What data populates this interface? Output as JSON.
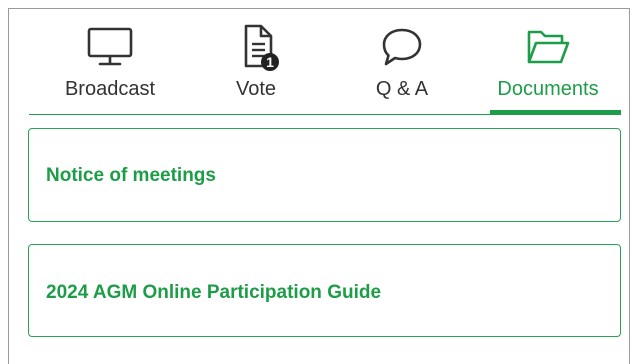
{
  "tabs": [
    {
      "label": "Broadcast",
      "icon": "monitor-icon",
      "active": false
    },
    {
      "label": "Vote",
      "icon": "document-icon",
      "badge": "1",
      "active": false
    },
    {
      "label": "Q & A",
      "icon": "speech-bubble-icon",
      "active": false
    },
    {
      "label": "Documents",
      "icon": "folder-open-icon",
      "active": true
    }
  ],
  "documents": [
    {
      "title": "Notice of meetings"
    },
    {
      "title": "2024 AGM Online Participation Guide"
    }
  ],
  "colors": {
    "accent": "#1e9d48",
    "text": "#333333",
    "border": "#9a9a9a"
  }
}
